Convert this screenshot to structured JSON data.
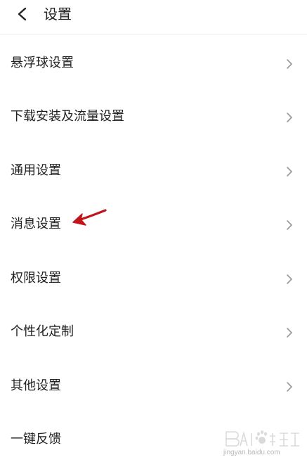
{
  "header": {
    "back_icon": "chevron-left-icon",
    "title": "设置"
  },
  "menu": {
    "items": [
      {
        "label": "悬浮球设置",
        "has_chevron": true
      },
      {
        "label": "下载安装及流量设置",
        "has_chevron": true
      },
      {
        "label": "通用设置",
        "has_chevron": true
      },
      {
        "label": "消息设置",
        "has_chevron": true
      },
      {
        "label": "权限设置",
        "has_chevron": true
      },
      {
        "label": "个性化定制",
        "has_chevron": true
      },
      {
        "label": "其他设置",
        "has_chevron": true
      },
      {
        "label": "一键反馈",
        "has_chevron": false
      }
    ]
  },
  "annotation": {
    "icon": "red-arrow-icon",
    "color": "#c0151b"
  },
  "watermark": {
    "icon": "baidu-jingyan-logo",
    "text": "jingyan.baidu.com"
  },
  "colors": {
    "text": "#222222",
    "chevron": "#999999",
    "divider": "#eeeeee",
    "background": "#ffffff"
  }
}
